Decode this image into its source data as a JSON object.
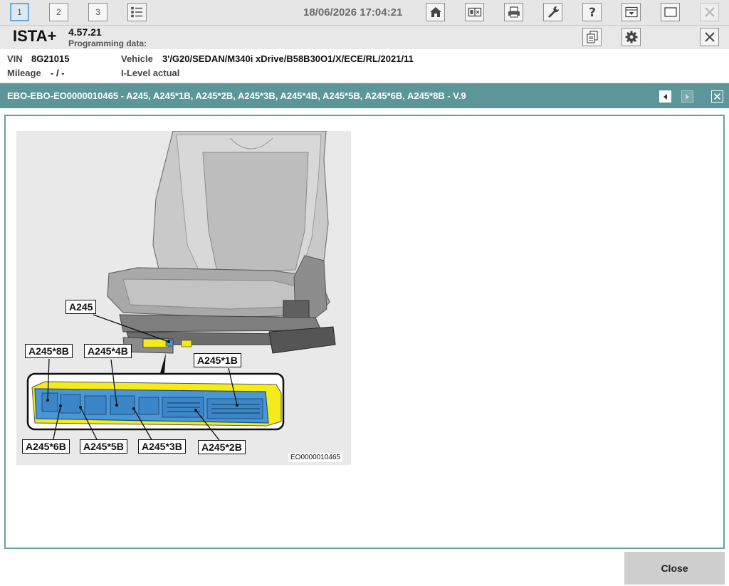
{
  "toolbar": {
    "session_tabs": [
      "1",
      "2",
      "3"
    ],
    "datetime": "18/06/2026 17:04:21",
    "icons": [
      "list-icon",
      "home-icon",
      "split-view-icon",
      "print-icon",
      "wrench-icon",
      "help-icon",
      "dropdown-panel-icon",
      "window-icon",
      "close-icon"
    ]
  },
  "app": {
    "name": "ISTA+",
    "version": "4.57.21",
    "programming_label": "Programming data:"
  },
  "vehicle": {
    "vin_label": "VIN",
    "vin": "8G21015",
    "mileage_label": "Mileage",
    "mileage": "- / -",
    "vehicle_label": "Vehicle",
    "vehicle": "3'/G20/SEDAN/M340i xDrive/B58B30O1/X/ECE/RL/2021/11",
    "ilevel_label": "I-Level actual"
  },
  "document": {
    "title": "EBO-EBO-EO0000010465 - A245, A245*1B, A245*2B, A245*3B, A245*4B, A245*5B, A245*6B, A245*8B - V.9"
  },
  "figure": {
    "labels": {
      "a245": "A245",
      "a245_8b": "A245*8B",
      "a245_4b": "A245*4B",
      "a245_1b": "A245*1B",
      "a245_6b": "A245*6B",
      "a245_5b": "A245*5B",
      "a245_3b": "A245*3B",
      "a245_2b": "A245*2B"
    },
    "id": "EO0000010465"
  },
  "footer": {
    "close_label": "Close"
  },
  "colors": {
    "title_bar": "#5d9698",
    "connector_blue": "#4a97d8",
    "connector_yellow": "#f4ec1a"
  }
}
